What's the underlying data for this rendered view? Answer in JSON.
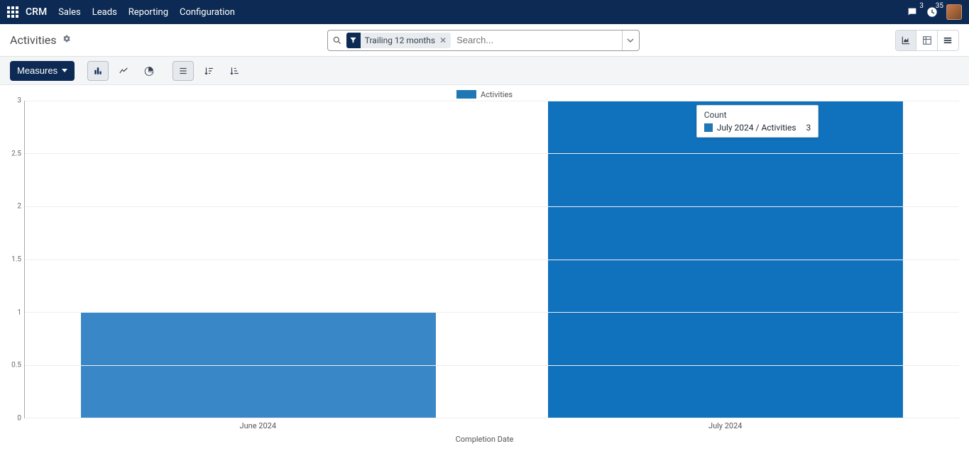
{
  "nav": {
    "brand": "CRM",
    "items": [
      "Sales",
      "Leads",
      "Reporting",
      "Configuration"
    ],
    "chat_badge": "3",
    "clock_badge": "35"
  },
  "header": {
    "title": "Activities"
  },
  "search": {
    "filter_label": "Trailing 12 months",
    "placeholder": "Search..."
  },
  "toolbar": {
    "measures": "Measures"
  },
  "legend": {
    "series": "Activities"
  },
  "tooltip": {
    "title": "Count",
    "label": "July 2024 / Activities",
    "value": "3"
  },
  "chart_data": {
    "type": "bar",
    "series_name": "Activities",
    "categories": [
      "June 2024",
      "July 2024"
    ],
    "values": [
      1,
      3
    ],
    "xlabel": "Completion Date",
    "ylabel": "",
    "y_ticks": [
      0,
      0.5,
      1,
      1.5,
      2,
      2.5,
      3
    ],
    "ylim": [
      0,
      3
    ],
    "colors": [
      "#3a87c8",
      "#1072bd"
    ]
  }
}
